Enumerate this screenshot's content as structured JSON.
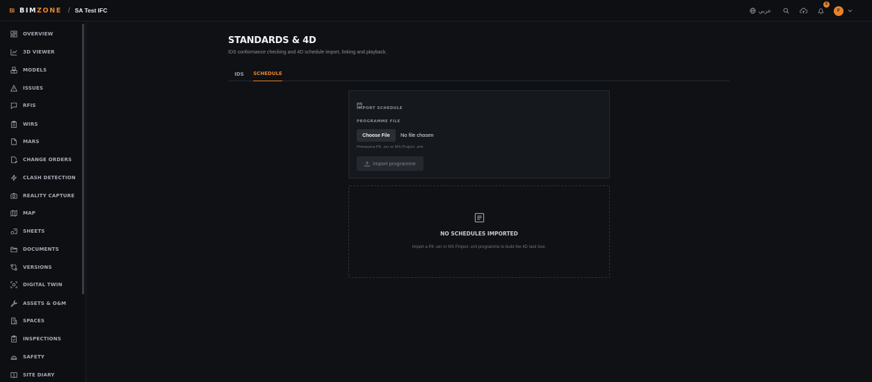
{
  "header": {
    "logo_mark": "BI",
    "logo_bim": "BIM",
    "logo_zone": "ZONE",
    "separator": "/",
    "project": "SA Test IFC",
    "language": "عربي",
    "notification_count": "5",
    "avatar_initial": "F",
    "accent_color": "#e8832a"
  },
  "sidebar": {
    "items": [
      {
        "label": "OVERVIEW",
        "icon": "grid-icon"
      },
      {
        "label": "3D VIEWER",
        "icon": "chart-icon"
      },
      {
        "label": "MODELS",
        "icon": "cubes-icon"
      },
      {
        "label": "ISSUES",
        "icon": "warning-icon"
      },
      {
        "label": "RFIS",
        "icon": "message-icon"
      },
      {
        "label": "WIRS",
        "icon": "clipboard-icon"
      },
      {
        "label": "MARS",
        "icon": "file-icon"
      },
      {
        "label": "CHANGE ORDERS",
        "icon": "edit-file-icon"
      },
      {
        "label": "CLASH DETECTION",
        "icon": "bolt-icon"
      },
      {
        "label": "REALITY CAPTURE",
        "icon": "camera-icon"
      },
      {
        "label": "MAP",
        "icon": "map-icon"
      },
      {
        "label": "SHEETS",
        "icon": "sheets-icon"
      },
      {
        "label": "DOCUMENTS",
        "icon": "folder-icon"
      },
      {
        "label": "VERSIONS",
        "icon": "branch-icon"
      },
      {
        "label": "DIGITAL TWIN",
        "icon": "scan-icon"
      },
      {
        "label": "ASSETS & O&M",
        "icon": "wrench-icon"
      },
      {
        "label": "SPACES",
        "icon": "building-icon"
      },
      {
        "label": "INSPECTIONS",
        "icon": "checklist-icon"
      },
      {
        "label": "SAFETY",
        "icon": "helmet-icon"
      },
      {
        "label": "SITE DIARY",
        "icon": "book-icon"
      }
    ]
  },
  "main": {
    "title": "STANDARDS & 4D",
    "subtitle": "IDS conformance checking and 4D schedule import, linking and playback.",
    "tabs": [
      {
        "label": "IDS",
        "active": false
      },
      {
        "label": "SCHEDULE",
        "active": true
      }
    ],
    "import_card": {
      "title": "IMPORT SCHEDULE",
      "field_label": "PROGRAMME FILE",
      "choose_file": "Choose File",
      "file_status": "No file chosen",
      "hint": "Primavera P6 .xer or MS Project .xml",
      "import_button": "Import programme"
    },
    "empty_state": {
      "title": "NO SCHEDULES IMPORTED",
      "description": "Import a P6 .xer or MS Project .xml programme to build the 4D task tree."
    }
  }
}
